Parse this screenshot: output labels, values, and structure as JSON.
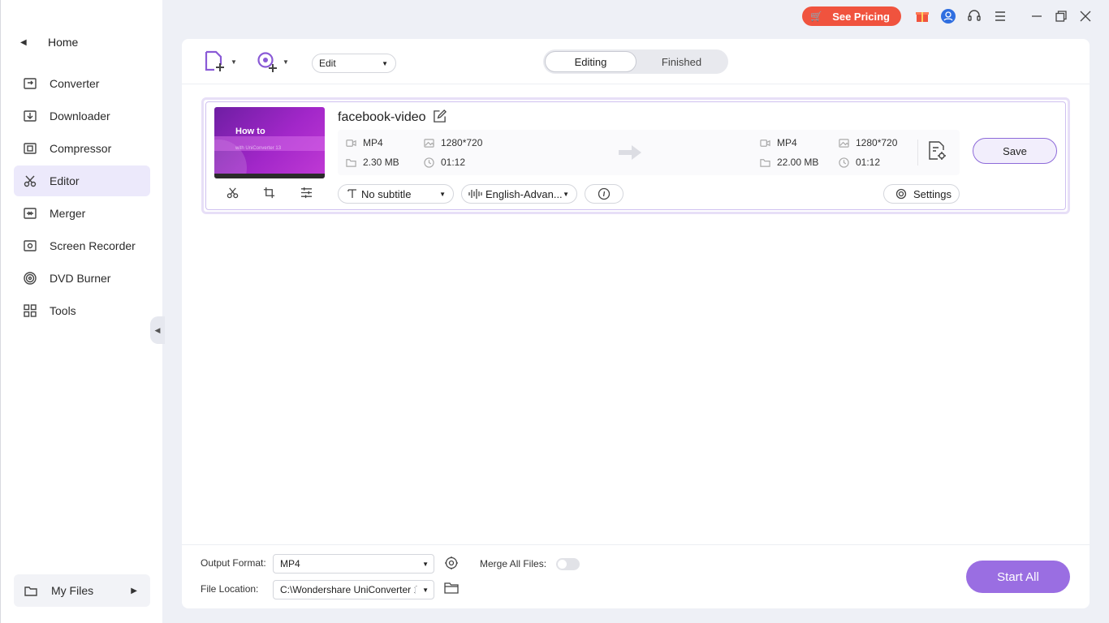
{
  "titlebar": {
    "pricing_label": "See Pricing",
    "accent_color": "#f0533e"
  },
  "sidebar": {
    "home_label": "Home",
    "items": [
      {
        "label": "Converter",
        "icon": "converter-icon"
      },
      {
        "label": "Downloader",
        "icon": "downloader-icon"
      },
      {
        "label": "Compressor",
        "icon": "compressor-icon"
      },
      {
        "label": "Editor",
        "icon": "editor-icon",
        "active": true
      },
      {
        "label": "Merger",
        "icon": "merger-icon"
      },
      {
        "label": "Screen Recorder",
        "icon": "screen-recorder-icon"
      },
      {
        "label": "DVD Burner",
        "icon": "dvd-burner-icon"
      },
      {
        "label": "Tools",
        "icon": "tools-icon"
      }
    ],
    "my_files_label": "My Files"
  },
  "toolbar": {
    "edit_select_value": "Edit",
    "tabs": [
      {
        "label": "Editing",
        "active": true
      },
      {
        "label": "Finished",
        "active": false
      }
    ]
  },
  "file": {
    "title": "facebook-video",
    "thumbnail_text": "How to",
    "thumbnail_subtext": "with UniConverter 13",
    "source": {
      "format": "MP4",
      "resolution": "1280*720",
      "size": "2.30 MB",
      "duration": "01:12"
    },
    "target": {
      "format": "MP4",
      "resolution": "1280*720",
      "size": "22.00 MB",
      "duration": "01:12"
    },
    "subtitle_value": "No subtitle",
    "audio_value": "English-Advan...",
    "settings_label": "Settings",
    "save_label": "Save"
  },
  "bottom": {
    "output_format_label": "Output Format:",
    "output_format_value": "MP4",
    "merge_label": "Merge All Files:",
    "merge_enabled": false,
    "file_location_label": "File Location:",
    "file_location_value": "C:\\Wondershare UniConverter 1",
    "start_all_label": "Start All"
  }
}
